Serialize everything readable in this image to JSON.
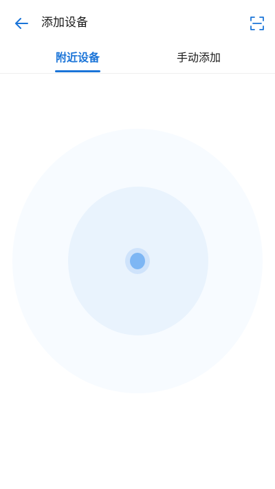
{
  "header": {
    "title": "添加设备",
    "back_icon": "arrow-left-icon",
    "scan_icon": "scan-icon"
  },
  "tabs": [
    {
      "label": "附近设备",
      "active": true
    },
    {
      "label": "手动添加",
      "active": false
    }
  ],
  "colors": {
    "accent": "#1a74d8",
    "radar_outer": "#f7fbff",
    "radar_inner": "#e9f3fd",
    "dot": "#7db6f4"
  }
}
